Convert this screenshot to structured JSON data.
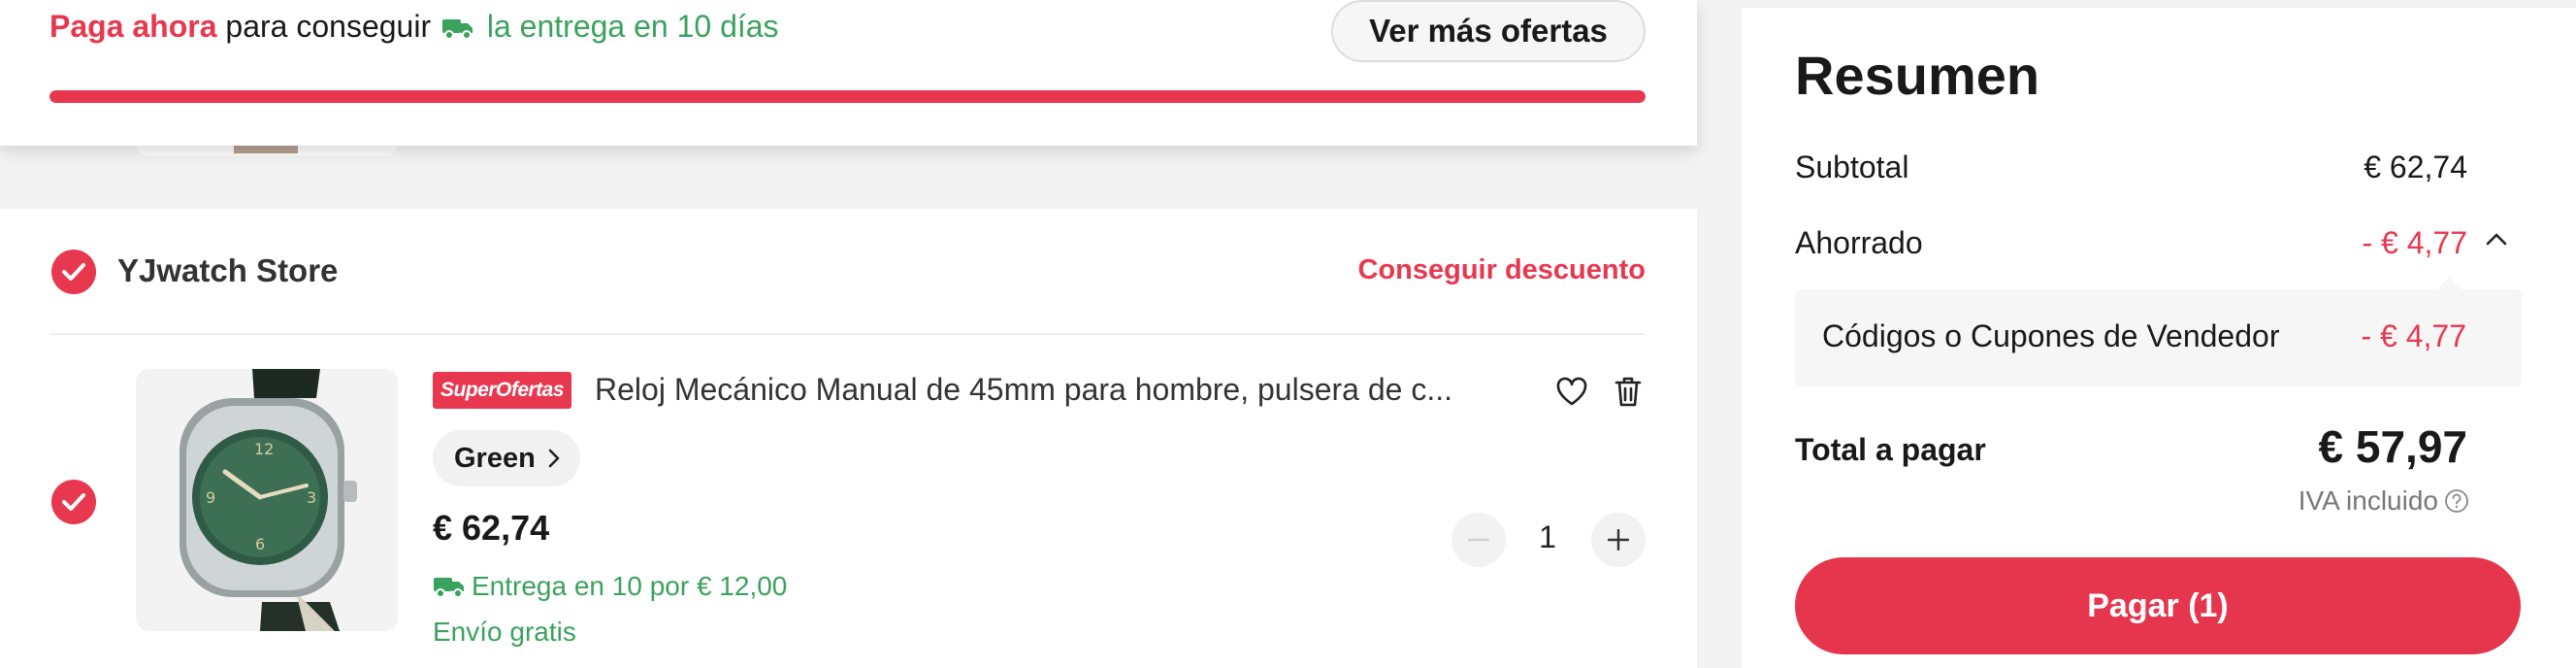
{
  "promo": {
    "pay_now": "Paga ahora",
    "to_get": "para conseguir",
    "delivery": "la entrega en 10 días",
    "more_offers_label": "Ver más ofertas",
    "progress_fraction": 1.0
  },
  "store": {
    "name": "YJwatch Store",
    "discount_link": "Conseguir descuento",
    "selected": true
  },
  "item": {
    "selected": true,
    "badge": "SuperOfertas",
    "title": "Reloj Mecánico Manual de 45mm para hombre, pulsera de c...",
    "variant": "Green",
    "price": "€ 62,74",
    "delivery": "Entrega en 10 por € 12,00",
    "shipping": "Envío gratis",
    "quantity": "1",
    "icons": {
      "wishlist": "heart-icon",
      "delete": "trash-icon",
      "decrease": "minus-icon",
      "increase": "plus-icon"
    }
  },
  "summary": {
    "title": "Resumen",
    "subtotal_label": "Subtotal",
    "subtotal_value": "€ 62,74",
    "saved_label": "Ahorrado",
    "saved_value": "- € 4,77",
    "coupon_label": "Códigos o Cupones de Vendedor",
    "coupon_value": "- € 4,77",
    "total_label": "Total a pagar",
    "total_value": "€ 57,97",
    "vat_note": "IVA incluido",
    "pay_button": "Pagar (1)"
  },
  "colors": {
    "accent_red": "#e8384f",
    "delivery_green": "#3aa25c"
  }
}
